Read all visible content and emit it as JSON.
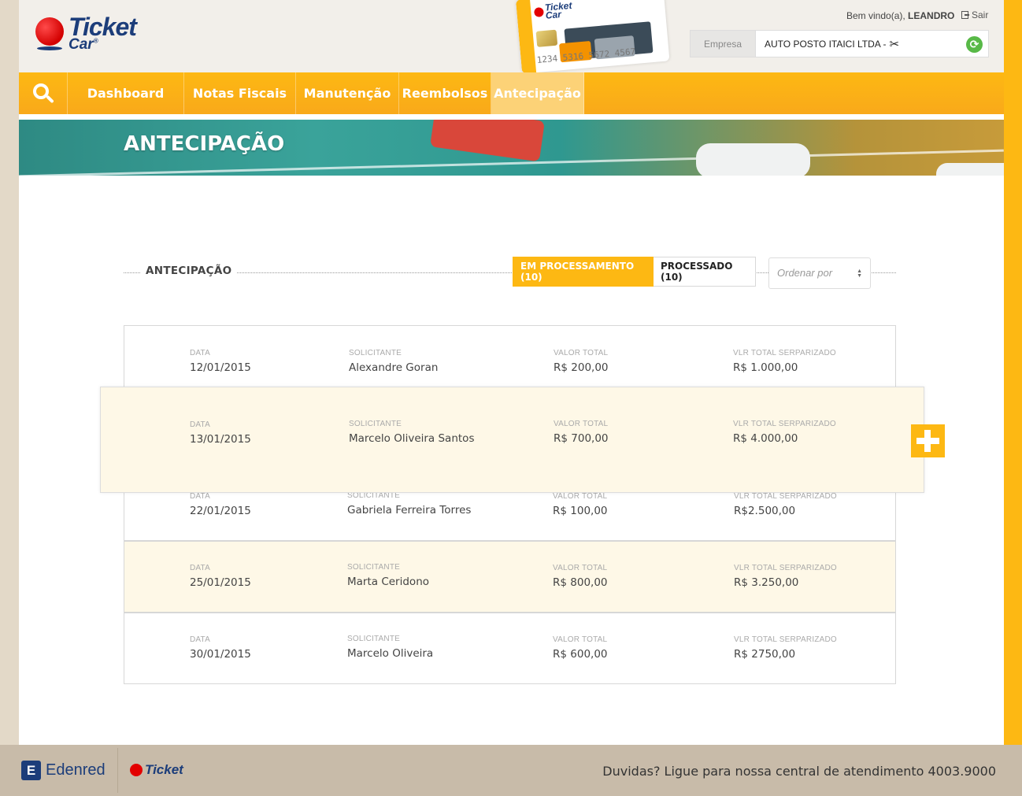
{
  "brand": {
    "logo_ticket": "Ticket",
    "logo_car": "Car",
    "logo_reg": "®"
  },
  "card": {
    "logo": "Ticket Car",
    "number": "1234 5316 5672 4567"
  },
  "user": {
    "welcome": "Bem vindo(a),",
    "name": "LEANDRO",
    "logout": "Sair",
    "empresa_label": "Empresa",
    "empresa_value": "AUTO POSTO ITAICI LTDA -"
  },
  "nav": {
    "items": [
      {
        "label": "Dashboard"
      },
      {
        "label": "Notas Fiscais"
      },
      {
        "label": "Manutenção"
      },
      {
        "label": "Reembolsos"
      },
      {
        "label": "Antecipação"
      }
    ]
  },
  "banner": {
    "title": "ANTECIPAÇÃO"
  },
  "section": {
    "title": "ANTECIPAÇÃO",
    "tabs": [
      {
        "label": "EM PROCESSAMENTO (10)"
      },
      {
        "label": "PROCESSADO (10)"
      }
    ],
    "order_placeholder": "Ordenar por"
  },
  "columns": {
    "data": "DATA",
    "solicitante": "SOLICITANTE",
    "valor_total": "VALOR TOTAL",
    "vlr_total_serparizado": "VLR TOTAL SERPARIZADO"
  },
  "rows": [
    {
      "data": "12/01/2015",
      "solicitante": "Alexandre Goran",
      "valor_total": "R$ 200,00",
      "vlr_total_serparizado": "R$ 1.000,00"
    },
    {
      "data": "13/01/2015",
      "solicitante": "Marcelo Oliveira Santos",
      "valor_total": "R$ 700,00",
      "vlr_total_serparizado": "R$ 4.000,00"
    },
    {
      "data": "22/01/2015",
      "solicitante": "Gabriela Ferreira Torres",
      "valor_total": "R$ 100,00",
      "vlr_total_serparizado": "R$2.500,00"
    },
    {
      "data": "25/01/2015",
      "solicitante": "Marta Ceridono",
      "valor_total": "R$ 800,00",
      "vlr_total_serparizado": "R$ 3.250,00"
    },
    {
      "data": "30/01/2015",
      "solicitante": "Marcelo Oliveira",
      "valor_total": "R$ 600,00",
      "vlr_total_serparizado": "R$ 2750,00"
    }
  ],
  "footer": {
    "edenred": "Edenred",
    "ticket": "Ticket",
    "help": "Duvidas? Ligue para nossa central de atendimento 4003.9000"
  },
  "colors": {
    "accent": "#fdb813",
    "brand_blue": "#1c3d7a",
    "brand_red": "#e30000",
    "highlight_row": "#fef8e7"
  },
  "icons": [
    "search-icon",
    "tools-icon",
    "refresh-icon",
    "logout-icon",
    "plus-icon",
    "sort-arrows-icon"
  ]
}
